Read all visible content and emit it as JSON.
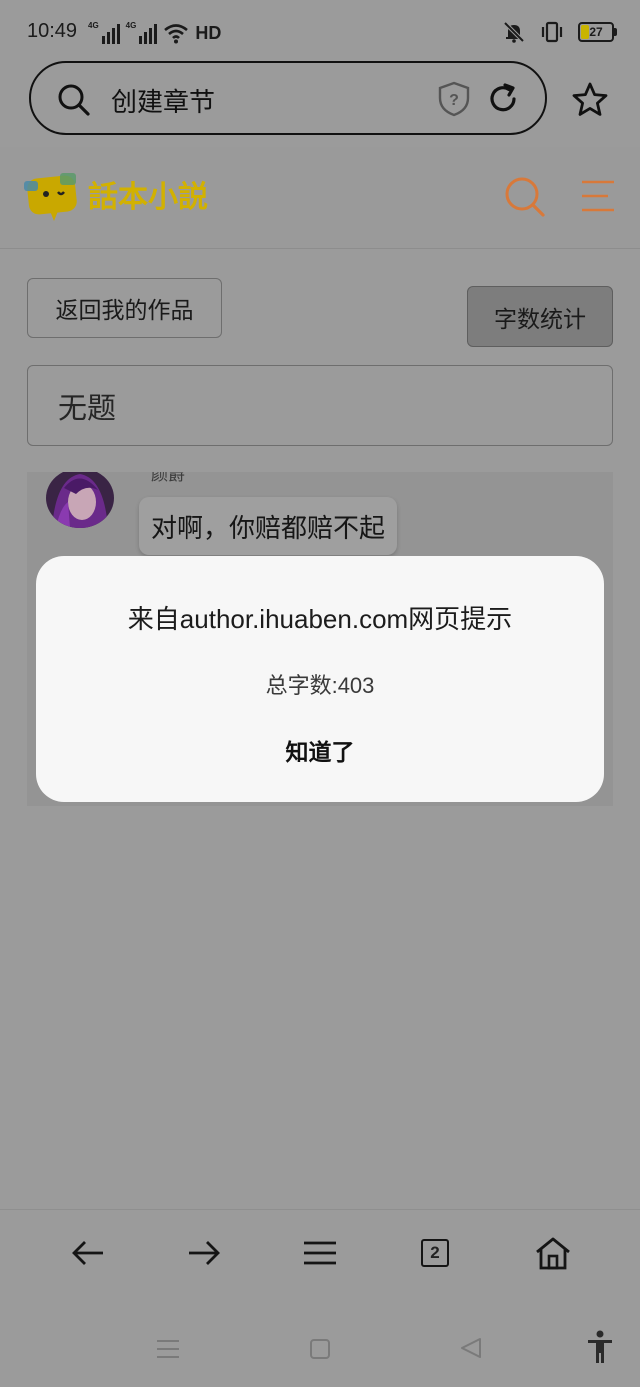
{
  "status_bar": {
    "time": "10:49",
    "network_1": "4G",
    "network_2": "4G",
    "hd_label": "HD",
    "battery_level": "27",
    "battery_fraction": 0.27
  },
  "browser": {
    "url_text": "创建章节",
    "icons": [
      "search-icon",
      "security-shield-icon",
      "reload-icon",
      "bookmark-star-icon"
    ]
  },
  "site": {
    "logo_text": "話本小説",
    "icons": [
      "search-icon",
      "menu-icon"
    ]
  },
  "page": {
    "back_button": "返回我的作品",
    "word_count_button": "字数统计",
    "chapter_title": "无题"
  },
  "chat": {
    "sender_name": "颜爵",
    "message": "对啊，你赔都赔不起"
  },
  "dialog": {
    "title": "来自author.ihuaben.com网页提示",
    "message": "总字数:403",
    "ok_label": "知道了"
  },
  "toolbar": {
    "tab_count": "2",
    "icons": [
      "back-arrow-icon",
      "forward-arrow-icon",
      "menu-icon",
      "tabs-icon",
      "home-icon"
    ]
  },
  "colors": {
    "overlay_gray": "#9b9b9b",
    "dialog_bg": "#f7f7f7",
    "logo_yellow": "#d9b800",
    "accent_orange": "#e07a3a"
  }
}
